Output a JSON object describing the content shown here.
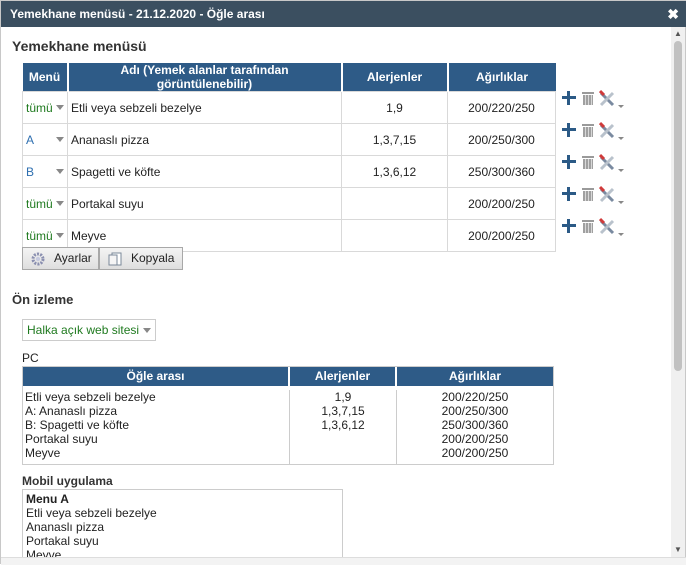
{
  "window": {
    "title": "Yemekhane menüsü - 21.12.2020 - Öğle arası",
    "close_glyph": "✖"
  },
  "menu_section": {
    "heading": "Yemekhane menüsü",
    "columns": [
      "Menü",
      "Adı (Yemek alanlar tarafından görüntülenebilir)",
      "Alerjenler",
      "Ağırlıklar"
    ],
    "rows": [
      {
        "menu": "tümü",
        "name": "Etli veya sebzeli bezelye",
        "allergens": "1,9",
        "weights": "200/220/250"
      },
      {
        "menu": "A",
        "name": "Ananaslı pizza",
        "allergens": "1,3,7,15",
        "weights": "200/250/300"
      },
      {
        "menu": "B",
        "name": "Spagetti ve köfte",
        "allergens": "1,3,6,12",
        "weights": "250/300/360"
      },
      {
        "menu": "tümü",
        "name": "Portakal suyu",
        "allergens": "",
        "weights": "200/200/250"
      },
      {
        "menu": "tümü",
        "name": "Meyve",
        "allergens": "",
        "weights": "200/200/250"
      }
    ],
    "settings_button": "Ayarlar",
    "copy_button": "Kopyala"
  },
  "preview": {
    "heading": "Ön izleme",
    "visibility_select": "Halka açık web sitesi",
    "pc_label": "PC",
    "pc_columns": [
      "Öğle arası",
      "Alerjenler",
      "Ağırlıklar"
    ],
    "pc_items": [
      "Etli veya sebzeli bezelye",
      "A: Ananaslı pizza",
      "B: Spagetti ve köfte",
      "Portakal suyu",
      "Meyve"
    ],
    "pc_allergens": [
      "1,9",
      "1,3,7,15",
      "1,3,6,12"
    ],
    "pc_weights": [
      "200/220/250",
      "200/250/300",
      "250/300/360",
      "200/200/250",
      "200/200/250"
    ],
    "mobile_label": "Mobil uygulama",
    "mobile_menu_title": "Menu A",
    "mobile_items": [
      "Etli veya sebzeli bezelye",
      "Ananaslı pizza",
      "Portakal suyu",
      "Meyve"
    ]
  },
  "colors": {
    "titlebar": "#3b4f60",
    "table_header": "#2e5b87",
    "all_menu_text": "#1f7a1f",
    "letter_menu_text": "#2e6fb0",
    "plus_icon": "#2b5a86"
  },
  "icons": {
    "row_actions": [
      "plus-icon",
      "trash-icon",
      "tools-icon"
    ],
    "settings": "gear-icon",
    "copy": "copy-icon"
  }
}
